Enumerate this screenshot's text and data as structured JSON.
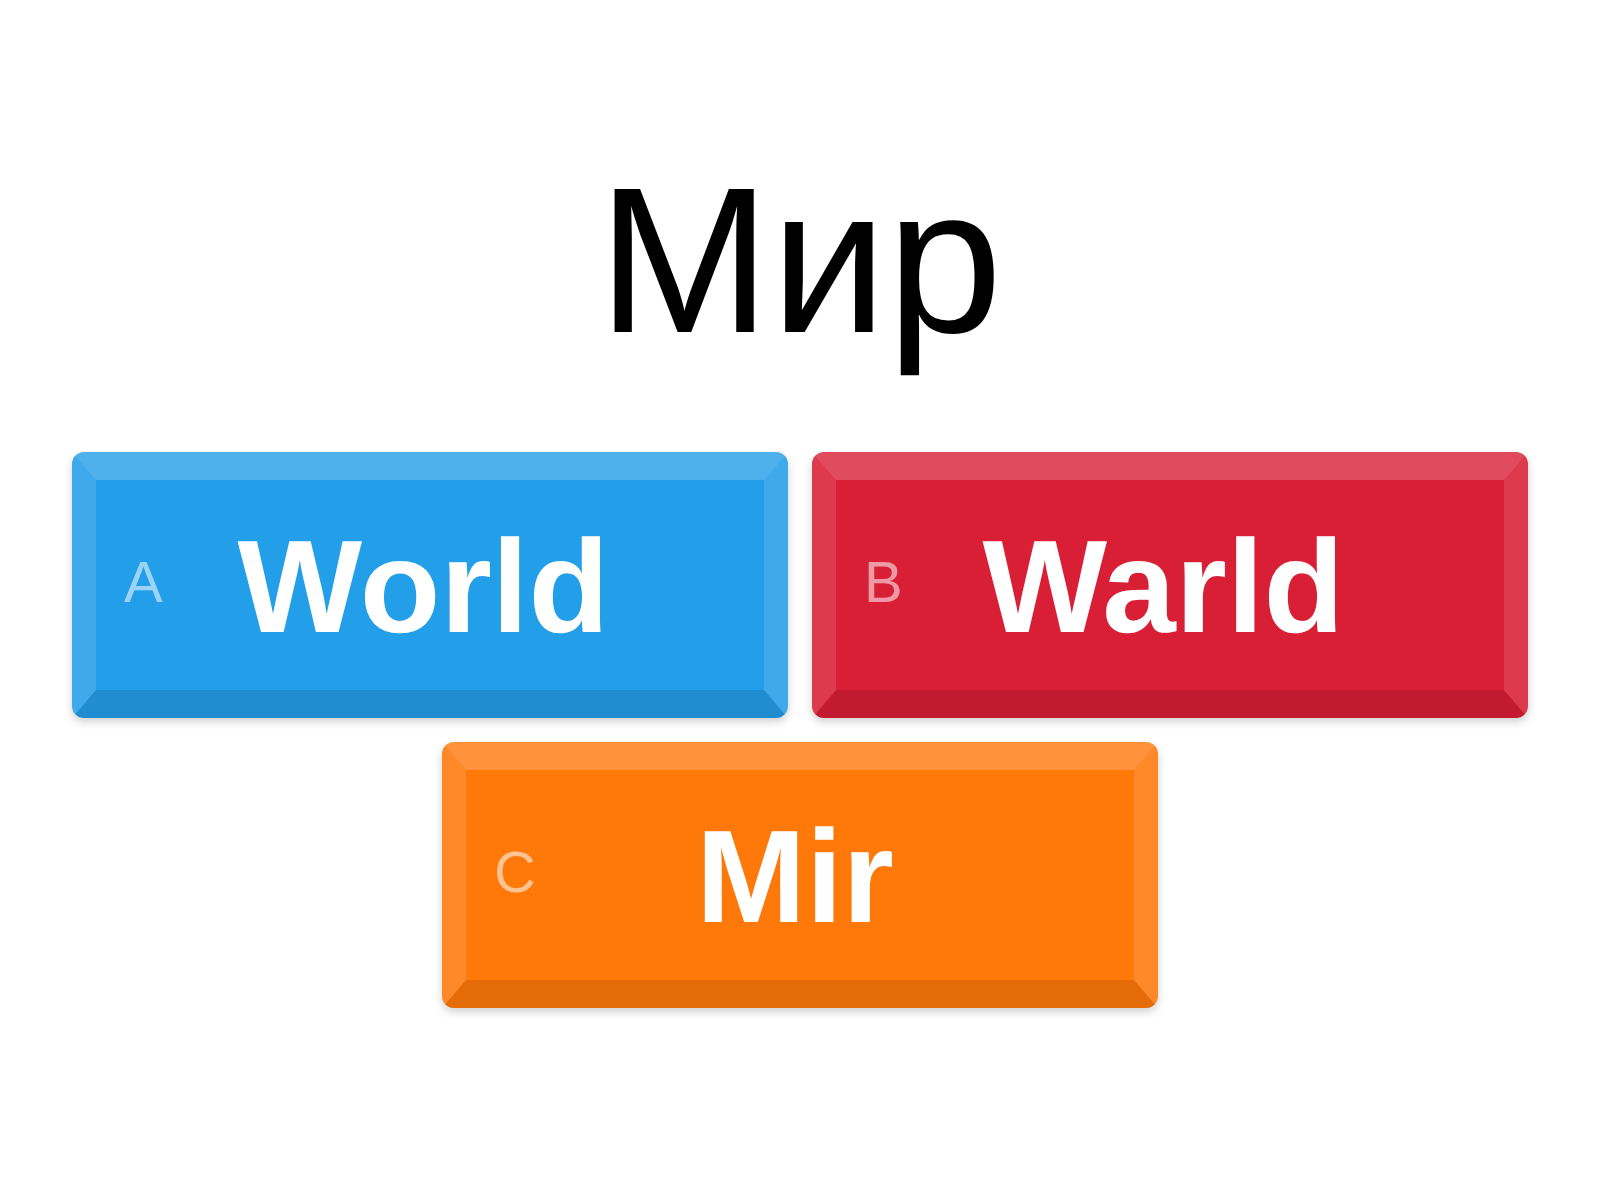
{
  "question": {
    "text": "Мир"
  },
  "answers": [
    {
      "letter": "A",
      "text": "World",
      "color": "#239ee8"
    },
    {
      "letter": "B",
      "text": "Warld",
      "color": "#d91f35"
    },
    {
      "letter": "C",
      "text": "Mir",
      "color": "#ff780a"
    }
  ]
}
